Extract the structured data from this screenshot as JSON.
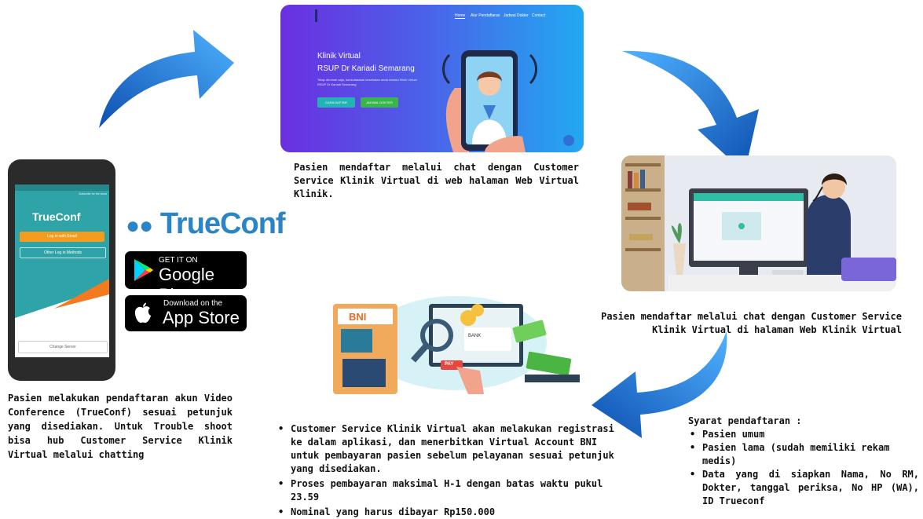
{
  "phone": {
    "brand": "TrueConf",
    "login_button": "Log in with Email",
    "other_login": "Other Log in Methods",
    "change_server": "Change Server",
    "header_text": "Subscribe for the cloud"
  },
  "store": {
    "trueconf_logo": "TrueConf",
    "google_small": "GET IT ON",
    "google_big": "Google Play",
    "apple_small": "Download on the",
    "apple_big": "App Store"
  },
  "website": {
    "nav": [
      "Home",
      "Alur Pendaftaran",
      "Jadwal Dokter",
      "Contact"
    ],
    "title_line1": "Klinik Virtual",
    "title_line2": "RSUP Dr Kariadi Semarang",
    "subtitle": "Tetap dirumah saja, konsultasikan kesehatan anda melalui Klinik Virtual RSUP Dr Kariadi Semarang",
    "button1": "CARA DAFTAR",
    "button2": "JADWAL DOKTER"
  },
  "bni": {
    "bank_logo": "BNI",
    "bank_label": "BANK",
    "pay_label": "PAY"
  },
  "captions": {
    "top_center": "Pasien mendaftar melalui chat dengan Customer Service Klinik Virtual di web halaman Web Virtual Klinik.",
    "right": "Pasien mendaftar melalui chat dengan Customer Service Klinik Virtual di halaman Web Klinik Virtual",
    "left": "Pasien melakukan pendaftaran akun Video Conference (TrueConf) sesuai petunjuk yang disediakan. Untuk Trouble shoot bisa hub Customer Service Klinik Virtual melalui chatting"
  },
  "bottom_list": [
    "Customer Service Klinik Virtual akan melakukan registrasi ke dalam aplikasi, dan menerbitkan Virtual Account BNI untuk pembayaran pasien sebelum pelayanan sesuai petunjuk yang disediakan.",
    "Proses pembayaran maksimal H-1 dengan batas waktu pukul 23.59",
    "Nominal yang harus dibayar Rp150.000"
  ],
  "requirements": {
    "heading": "Syarat pendaftaran :",
    "items": [
      "Pasien umum",
      "Pasien lama (sudah memiliki rekam medis)",
      "Data yang di siapkan Nama, No RM, Dokter, tanggal periksa, No HP (WA), ID Trueconf"
    ]
  },
  "colors": {
    "arrow": "#1f7fe0",
    "teal": "#2ea3a8",
    "orange": "#f39c1f",
    "brand_blue": "#2a84c6"
  }
}
